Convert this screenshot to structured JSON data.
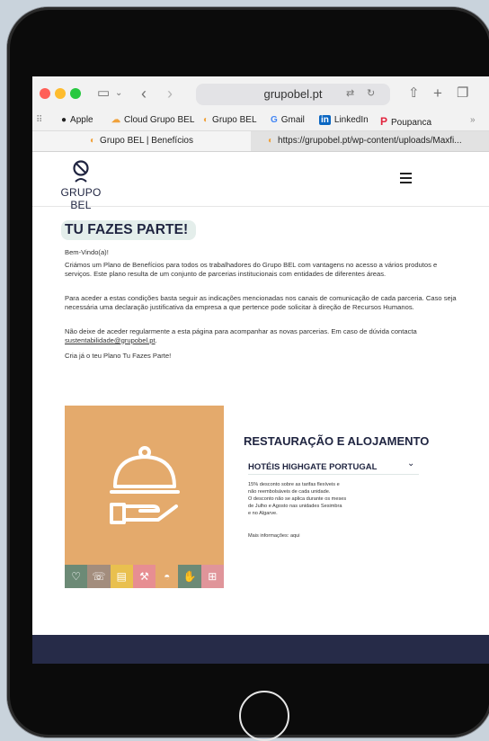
{
  "browser": {
    "url": "grupobel.pt",
    "favorites": [
      {
        "label": "Apple",
        "icon": "apple-icon"
      },
      {
        "label": "Cloud Grupo BEL",
        "icon": "cloud-icon"
      },
      {
        "label": "Grupo BEL",
        "icon": "bel-icon"
      },
      {
        "label": "Gmail",
        "icon": "google-icon"
      },
      {
        "label": "LinkedIn",
        "icon": "linkedin-icon"
      },
      {
        "label": "Poupanca",
        "icon": "poupanca-icon"
      }
    ],
    "tabs": [
      {
        "label": "Grupo BEL | Benefícios",
        "active": true
      },
      {
        "label": "https://grupobel.pt/wp-content/uploads/Maxfi...",
        "active": false
      }
    ]
  },
  "site": {
    "logo_text": "GRUPO BEL"
  },
  "content": {
    "title": "TU FAZES PARTE!",
    "welcome": "Bem-Vindo(a)!",
    "p1": "Criámos um Plano de Benefícios para todos os trabalhadores do Grupo BEL com vantagens no acesso a vários produtos e serviços. Este plano resulta de um conjunto de parcerias institucionais com entidades de diferentes áreas.",
    "p2": "Para aceder a estas condições basta seguir as indicações mencionadas nos canais de comunicação de cada parceria. Caso seja necessária uma declaração justificativa da empresa a que pertence pode solicitar à direção de Recursos Humanos.",
    "p3_pre": "Não deixe de aceder regularmente a esta página para acompanhar as novas parcerias. Em caso de dúvida contacta ",
    "p3_email": "sustentabilidade@grupobel.pt",
    "p3_post": ".",
    "p4": "Cria já o teu Plano Tu Fazes Parte!"
  },
  "services": {
    "section_title": "RESTAURAÇÃO E ALOJAMENTO",
    "image_icon": "cloche-icon",
    "category_icons": [
      {
        "icon": "heart-pulse-icon",
        "color": "#6c8a76"
      },
      {
        "icon": "phone-icon",
        "color": "#a38d7d"
      },
      {
        "icon": "document-icon",
        "color": "#e9c04f"
      },
      {
        "icon": "tools-icon",
        "color": "#e78e92"
      },
      {
        "icon": "cloche-icon",
        "color": "#e4aa6c"
      },
      {
        "icon": "handshake-icon",
        "color": "#6c8a76"
      },
      {
        "icon": "gift-icon",
        "color": "#e0959a"
      }
    ],
    "accordion": {
      "title": "HOTÉIS HIGHGATE PORTUGAL",
      "body_lines": [
        "15% desconto sobre as tarifas flexíveis e",
        "não reembolsáveis de cada unidade.",
        "O desconto não se aplica durante os meses",
        "de Julho e Agosto nas unidades Sesimbra",
        "e no Algarve."
      ],
      "more_label": "Mais informações: aqui"
    }
  },
  "colors": {
    "brand_navy": "#1f2440",
    "footer": "#262b48",
    "image_bg": "#e4aa6c"
  }
}
